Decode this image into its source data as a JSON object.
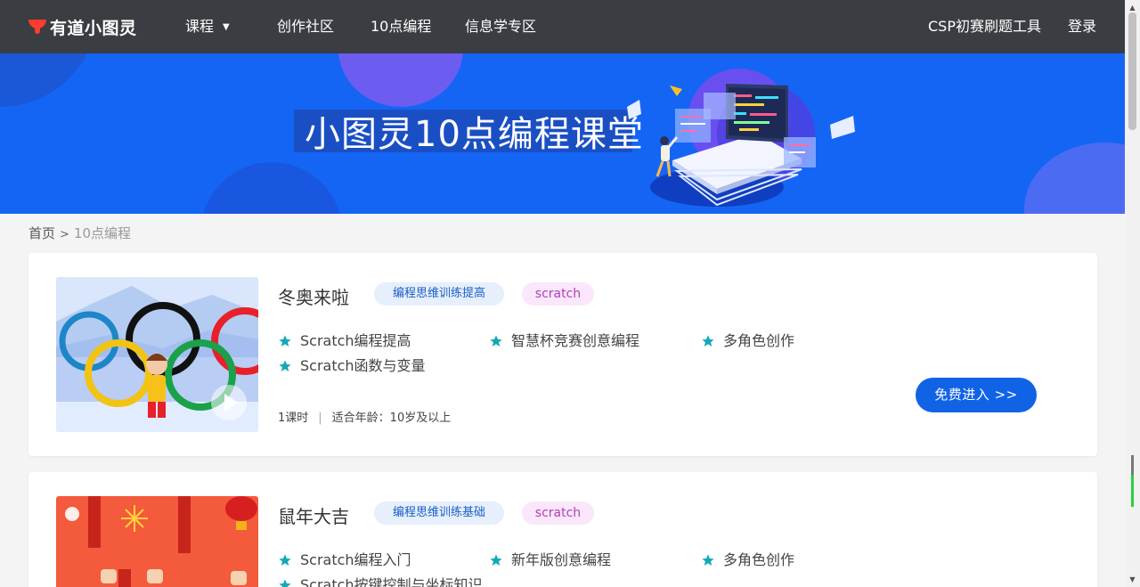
{
  "nav": {
    "logo_text": "有道小图灵",
    "courses": "课程",
    "community": "创作社区",
    "ten_oclock": "10点编程",
    "informatics": "信息学专区",
    "csp_tool": "CSP初赛刷题工具",
    "login": "登录"
  },
  "banner": {
    "title": "小图灵10点编程课堂"
  },
  "breadcrumb": {
    "home": "首页",
    "sep": ">",
    "current": "10点编程"
  },
  "courses": [
    {
      "title": "冬奥来啦",
      "level_tag": "编程思维训练提高",
      "lang_tag": "scratch",
      "features": [
        "Scratch编程提高",
        "智慧杯竞赛创意编程",
        "多角色创作",
        "Scratch函数与变量"
      ],
      "lessons": "1课时",
      "age": "适合年龄：10岁及以上",
      "button": "免费进入 >>"
    },
    {
      "title": "鼠年大吉",
      "level_tag": "编程思维训练基础",
      "lang_tag": "scratch",
      "features": [
        "Scratch编程入门",
        "新年版创意编程",
        "多角色创作",
        "Scratch按键控制与坐标知识"
      ]
    }
  ],
  "colors": {
    "nav_bg": "#3a3d42",
    "banner_bg": "#1565f5",
    "accent": "#1163e6",
    "star": "#12a9b8",
    "page_bg": "#f4f4f4"
  },
  "icons": {
    "star": "star-icon",
    "play": "play-icon",
    "caret": "caret-down-icon"
  }
}
